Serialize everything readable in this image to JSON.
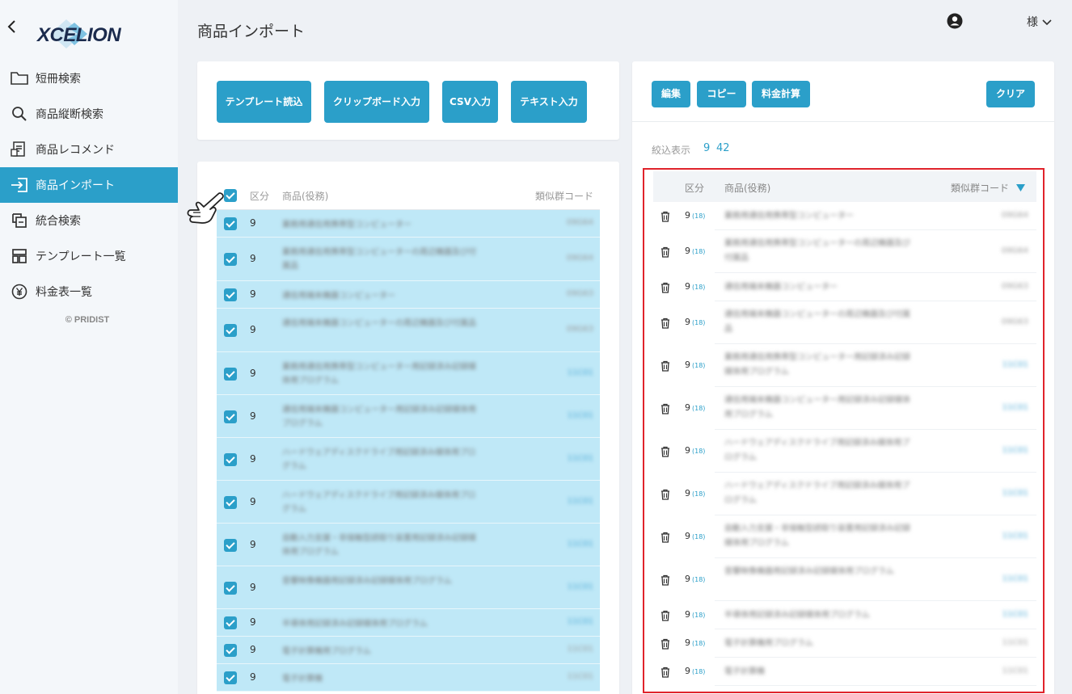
{
  "app": {
    "logo_text": "XCELION",
    "copyright": "© PRIDIST"
  },
  "header": {
    "title": "商品インポート",
    "user_label": "様"
  },
  "sidebar": {
    "items": [
      {
        "label": "短冊検索",
        "icon": "folder-icon",
        "active": false
      },
      {
        "label": "商品縦断検索",
        "icon": "search-icon",
        "active": false
      },
      {
        "label": "商品レコメンド",
        "icon": "recommend-icon",
        "active": false
      },
      {
        "label": "商品インポート",
        "icon": "import-icon",
        "active": true
      },
      {
        "label": "統合検索",
        "icon": "merge-icon",
        "active": false
      },
      {
        "label": "テンプレート一覧",
        "icon": "template-icon",
        "active": false
      },
      {
        "label": "料金表一覧",
        "icon": "yen-icon",
        "active": false
      }
    ]
  },
  "import_buttons": [
    "テンプレート読込",
    "クリップボード入力",
    "CSV入力",
    "テキスト入力"
  ],
  "right_buttons": {
    "edit": "編集",
    "copy": "コピー",
    "calc": "料金計算",
    "clear": "クリア"
  },
  "left_table": {
    "headers": {
      "kubun": "区分",
      "product": "商品(役務)",
      "code": "類似群コード"
    },
    "rows": [
      {
        "kubun": "9",
        "product": "業務用通信用携帯型コンピューター",
        "code": "09G64",
        "h": 34,
        "blue": false
      },
      {
        "kubun": "9",
        "product": "業務用通信用携帯型コンピューターの周辺機器及び付属品",
        "code": "09G64",
        "h": 54,
        "blue": false
      },
      {
        "kubun": "9",
        "product": "通信用端末機器コンピューター",
        "code": "09G63",
        "h": 34,
        "blue": false
      },
      {
        "kubun": "9",
        "product": "通信用端末機器コンピューターの周辺機器及び付属品",
        "code": "09G63",
        "h": 54,
        "blue": false
      },
      {
        "kubun": "9",
        "product": "業務用通信用携帯型コンピューター用記録済み記録媒体用プログラム",
        "code": "11C01",
        "h": 53,
        "blue": true
      },
      {
        "kubun": "9",
        "product": "通信用端末機器コンピューター用記録済み記録媒体用プログラム",
        "code": "11C01",
        "h": 53,
        "blue": true
      },
      {
        "kubun": "9",
        "product": "ハードウェアディスクドライブ用記録済み媒体用プログラム",
        "code": "11C01",
        "h": 53,
        "blue": true
      },
      {
        "kubun": "9",
        "product": "ハードウェアディスクドライブ用記録済み媒体用プログラム",
        "code": "11C01",
        "h": 53,
        "blue": true
      },
      {
        "kubun": "9",
        "product": "自動入力支援・非接触型読取り装置用記録済み記録媒体用プログラム",
        "code": "11C01",
        "h": 53,
        "blue": true
      },
      {
        "kubun": "9",
        "product": "音響映像機器用記録済み記録媒体用プログラム",
        "code": "11C01",
        "h": 53,
        "blue": true
      },
      {
        "kubun": "9",
        "product": "半導体用記録済み記録媒体用プログラム",
        "code": "11C01",
        "h": 34,
        "blue": true
      },
      {
        "kubun": "9",
        "product": "電子計算機用プログラム",
        "code": "11C01",
        "h": 34,
        "blue": false
      },
      {
        "kubun": "9",
        "product": "電子計算機",
        "code": "11C01",
        "h": 34,
        "blue": false
      }
    ]
  },
  "right_panel": {
    "filter_label": "絞込表示",
    "filter_values": [
      "9",
      "42"
    ],
    "headers": {
      "kubun": "区分",
      "product": "商品(役務)",
      "code": "類似群コード"
    },
    "rows": [
      {
        "kubun": "9",
        "sub": "(18)",
        "product": "業務用通信用携帯型コンピューター",
        "code": "09G64",
        "h": 35,
        "blue": false
      },
      {
        "kubun": "9",
        "sub": "(18)",
        "product": "業務用通信用携帯型コンピューターの周辺機器及び付属品",
        "code": "09G64",
        "h": 53,
        "blue": false
      },
      {
        "kubun": "9",
        "sub": "(18)",
        "product": "通信用端末機器コンピューター",
        "code": "09G63",
        "h": 35,
        "blue": false
      },
      {
        "kubun": "9",
        "sub": "(18)",
        "product": "通信用端末機器コンピューターの周辺機器及び付属品",
        "code": "09G63",
        "h": 53,
        "blue": false
      },
      {
        "kubun": "9",
        "sub": "(18)",
        "product": "業務用通信用携帯型コンピューター用記録済み記録媒体用プログラム",
        "code": "11C01",
        "h": 53,
        "blue": true
      },
      {
        "kubun": "9",
        "sub": "(18)",
        "product": "通信用端末機器コンピューター用記録済み記録媒体用プログラム",
        "code": "11C01",
        "h": 53,
        "blue": true
      },
      {
        "kubun": "9",
        "sub": "(18)",
        "product": "ハードウェアディスクドライブ用記録済み媒体用プログラム",
        "code": "11C01",
        "h": 53,
        "blue": true
      },
      {
        "kubun": "9",
        "sub": "(18)",
        "product": "ハードウェアディスクドライブ用記録済み媒体用プログラム",
        "code": "11C01",
        "h": 53,
        "blue": true
      },
      {
        "kubun": "9",
        "sub": "(18)",
        "product": "自動入力支援・非接触型読取り装置用記録済み記録媒体用プログラム",
        "code": "11C01",
        "h": 53,
        "blue": true
      },
      {
        "kubun": "9",
        "sub": "(18)",
        "product": "音響映像機器用記録済み記録媒体用プログラム",
        "code": "11C01",
        "h": 53,
        "blue": true
      },
      {
        "kubun": "9",
        "sub": "(18)",
        "product": "半導体用記録済み記録媒体用プログラム",
        "code": "11C01",
        "h": 35,
        "blue": true
      },
      {
        "kubun": "9",
        "sub": "(18)",
        "product": "電子計算機用プログラム",
        "code": "11C01",
        "h": 35,
        "blue": false
      },
      {
        "kubun": "9",
        "sub": "(18)",
        "product": "電子計算機",
        "code": "11C01",
        "h": 35,
        "blue": false
      }
    ]
  },
  "colors": {
    "accent": "#2b9fc9",
    "selected_row": "#bfe8f7",
    "highlight_border": "#e0232b"
  }
}
